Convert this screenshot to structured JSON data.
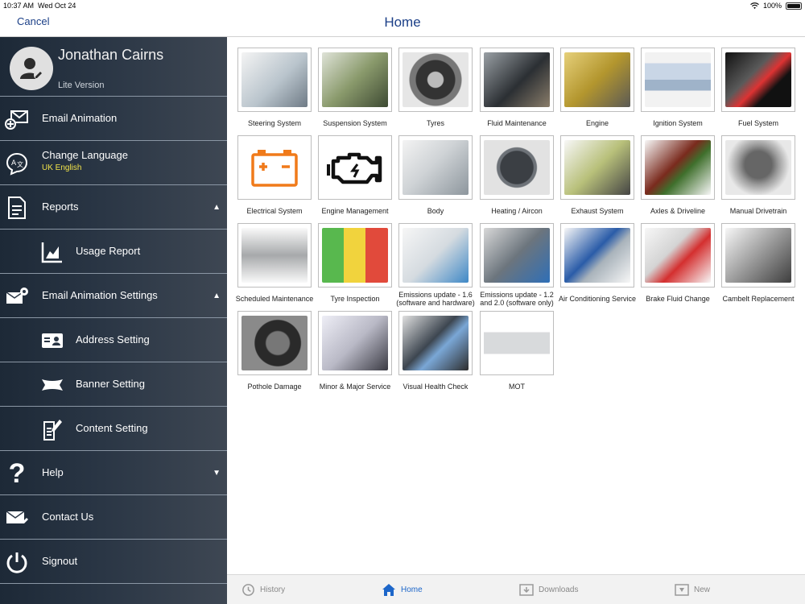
{
  "status": {
    "time": "10:37 AM",
    "date": "Wed Oct 24",
    "battery": "100%"
  },
  "navbar": {
    "cancel": "Cancel",
    "title": "Home"
  },
  "user": {
    "name": "Jonathan Cairns",
    "version": "Lite Version"
  },
  "menu": {
    "email_animation": "Email Animation",
    "change_language": "Change Language",
    "language_value": "UK English",
    "reports": "Reports",
    "usage_report": "Usage Report",
    "email_animation_settings": "Email Animation Settings",
    "address_setting": "Address Setting",
    "banner_setting": "Banner Setting",
    "content_setting": "Content Setting",
    "help": "Help",
    "contact_us": "Contact Us",
    "signout": "Signout"
  },
  "tiles": [
    {
      "label": "Steering System",
      "icon": "steering-system-image"
    },
    {
      "label": "Suspension System",
      "icon": "suspension-system-image"
    },
    {
      "label": "Tyres",
      "icon": "tyre-image"
    },
    {
      "label": "Fluid Maintenance",
      "icon": "fluid-maintenance-image"
    },
    {
      "label": "Engine",
      "icon": "engine-image"
    },
    {
      "label": "Ignition System",
      "icon": "spark-plug-image"
    },
    {
      "label": "Fuel System",
      "icon": "fuel-system-image"
    },
    {
      "label": "Electrical System",
      "icon": "battery-icon"
    },
    {
      "label": "Engine Management",
      "icon": "engine-warning-icon"
    },
    {
      "label": "Body",
      "icon": "car-body-image"
    },
    {
      "label": "Heating / Aircon",
      "icon": "climate-knob-image"
    },
    {
      "label": "Exhaust System",
      "icon": "exhaust-system-image"
    },
    {
      "label": "Axles & Driveline",
      "icon": "axles-image"
    },
    {
      "label": "Manual Drivetrain",
      "icon": "gear-knob-image"
    },
    {
      "label": "Scheduled Maintenance",
      "icon": "brake-pad-image"
    },
    {
      "label": "Tyre Inspection",
      "icon": "tyre-inspection-image"
    },
    {
      "label": "Emissions update - 1.6 (software and hardware)",
      "icon": "emissions-kit-image"
    },
    {
      "label": "Emissions update - 1.2 and 2.0 (software only)",
      "icon": "emissions-software-image"
    },
    {
      "label": "Air Conditioning Service",
      "icon": "ac-service-image"
    },
    {
      "label": "Brake Fluid Change",
      "icon": "brake-fluid-image"
    },
    {
      "label": "Cambelt Replacement",
      "icon": "cambelt-image"
    },
    {
      "label": "Pothole Damage",
      "icon": "pothole-wheel-image"
    },
    {
      "label": "Minor & Major Service",
      "icon": "service-engine-image"
    },
    {
      "label": "Visual Health Check",
      "icon": "engine-bay-image"
    },
    {
      "label": "MOT",
      "icon": "mot-car-image"
    }
  ],
  "tabs": {
    "history": "History",
    "home": "Home",
    "downloads": "Downloads",
    "new": "New"
  },
  "colors": {
    "accent": "#1b3f87",
    "active_tab": "#1d66c9",
    "language": "#f1e34a",
    "sidebar": "#2a3645"
  }
}
